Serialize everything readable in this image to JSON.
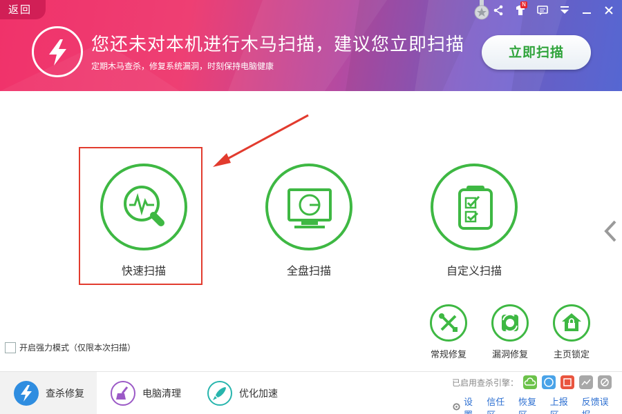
{
  "header": {
    "back_label": "返回",
    "headline": "您还未对本机进行木马扫描，建议您立即扫描",
    "subline": "定期木马查杀，修复系统漏洞，时刻保持电脑健康",
    "scan_now_label": "立即扫描",
    "badge_text": "N",
    "colors": {
      "banner_start": "#f0326a",
      "banner_end": "#5b6ee0",
      "accent_green": "#2ea33a"
    },
    "icons": [
      "lightning-icon",
      "medal-icon",
      "share-icon",
      "skin-icon",
      "message-icon",
      "menu-icon",
      "minimize-icon",
      "close-icon"
    ]
  },
  "scan_options": [
    {
      "label": "快速扫描",
      "icon": "magnifier-pulse-icon"
    },
    {
      "label": "全盘扫描",
      "icon": "monitor-icon"
    },
    {
      "label": "自定义扫描",
      "icon": "checklist-icon"
    }
  ],
  "tools": [
    {
      "label": "常规修复",
      "icon": "wrench-icon"
    },
    {
      "label": "漏洞修复",
      "icon": "shield-repair-icon"
    },
    {
      "label": "主页锁定",
      "icon": "home-lock-icon"
    }
  ],
  "strong_mode": {
    "label": "开启强力模式（仅限本次扫描）",
    "checked": false
  },
  "footer": {
    "tabs": [
      {
        "label": "查杀修复",
        "icon": "lightning-icon",
        "active": true
      },
      {
        "label": "电脑清理",
        "icon": "broom-icon",
        "active": false
      },
      {
        "label": "优化加速",
        "icon": "rocket-icon",
        "active": false
      }
    ],
    "engines_label": "已启用查杀引擎：",
    "links": {
      "settings": "设置",
      "trust": "信任区",
      "restore": "恢复区",
      "upload": "上报区",
      "feedback": "反馈误报"
    }
  },
  "colors": {
    "green": "#3eb843",
    "highlight_red": "#e23b2e",
    "link_blue": "#2d6fd1"
  }
}
